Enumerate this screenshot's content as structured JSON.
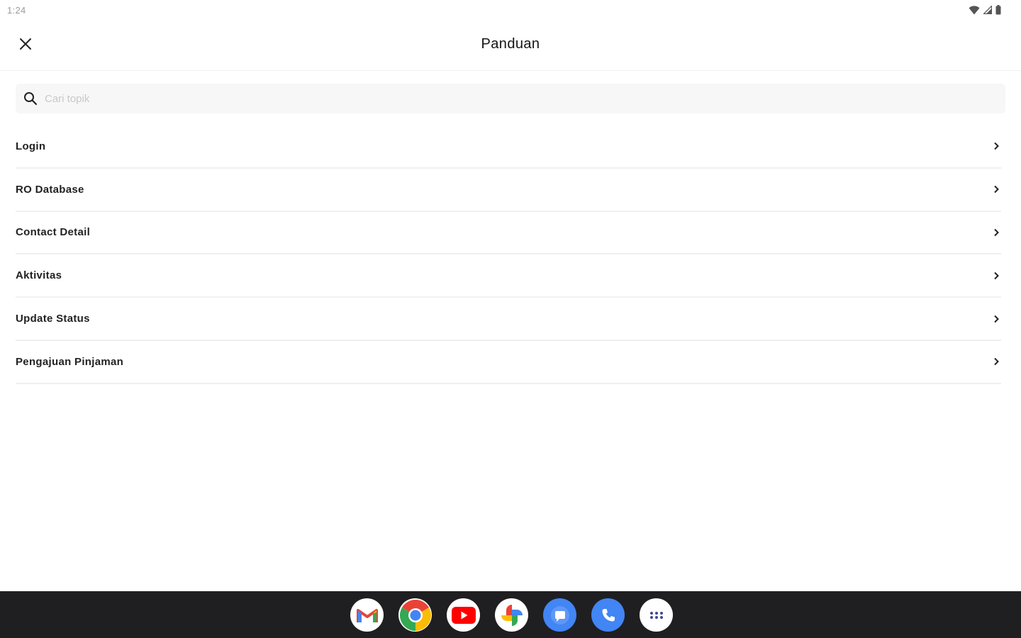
{
  "status_bar": {
    "time": "1:24",
    "icons": [
      "wifi-icon",
      "signal-icon",
      "battery-icon"
    ]
  },
  "app_bar": {
    "title": "Panduan",
    "close_icon": "close-icon"
  },
  "search": {
    "placeholder": "Cari topik",
    "value": "",
    "icon": "search-icon"
  },
  "topics": [
    {
      "label": "Login"
    },
    {
      "label": "RO Database"
    },
    {
      "label": "Contact Detail"
    },
    {
      "label": "Aktivitas"
    },
    {
      "label": "Update Status"
    },
    {
      "label": "Pengajuan Pinjaman"
    }
  ],
  "taskbar": {
    "apps": [
      {
        "name": "Gmail",
        "icon": "gmail-icon"
      },
      {
        "name": "Chrome",
        "icon": "chrome-icon"
      },
      {
        "name": "YouTube",
        "icon": "youtube-icon"
      },
      {
        "name": "Photos",
        "icon": "photos-icon"
      },
      {
        "name": "Messages",
        "icon": "messages-icon"
      },
      {
        "name": "Phone",
        "icon": "phone-icon"
      },
      {
        "name": "App drawer",
        "icon": "app-drawer-icon"
      }
    ]
  },
  "colors": {
    "background": "#ffffff",
    "taskbar": "#1f1f22",
    "search_bg": "#f7f7f7",
    "divider": "#f0f0f0",
    "placeholder": "#c9c9c9"
  }
}
